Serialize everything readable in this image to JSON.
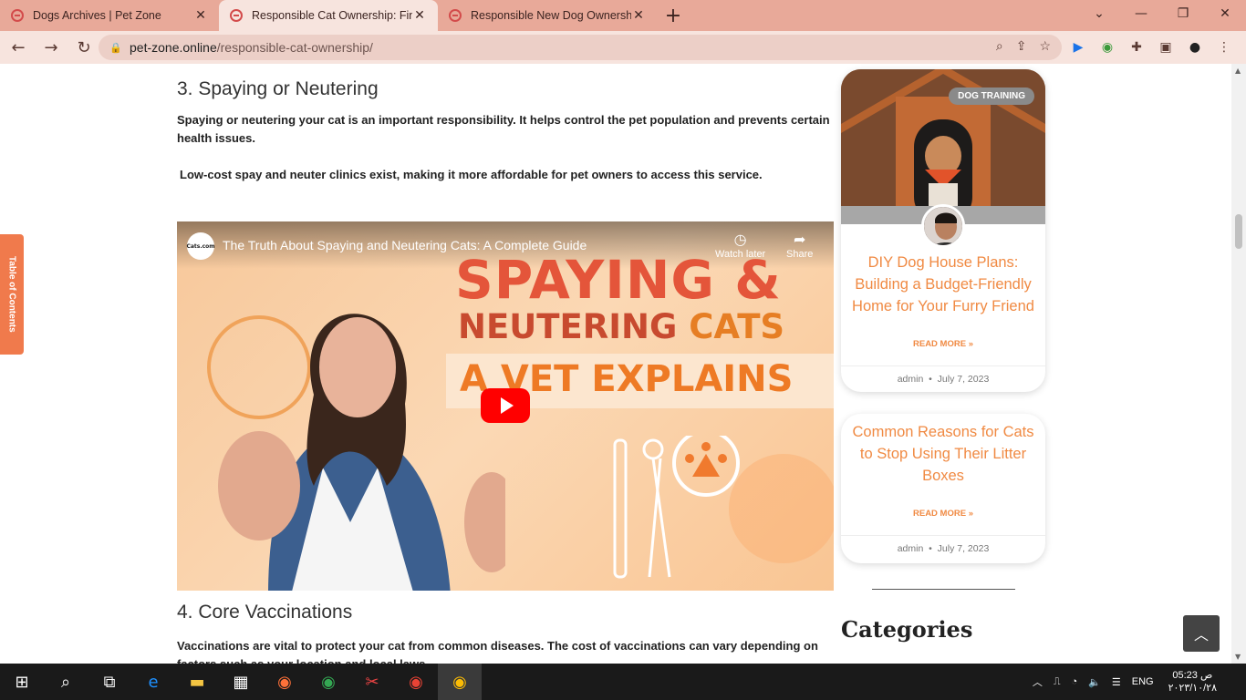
{
  "browser": {
    "tabs": [
      {
        "title": "Dogs Archives | Pet Zone",
        "active": false
      },
      {
        "title": "Responsible Cat Ownership: Fina",
        "active": true
      },
      {
        "title": "Responsible New Dog Ownershi",
        "active": false
      }
    ],
    "url_host": "pet-zone.online",
    "url_path": "/responsible-cat-ownership/"
  },
  "toc": {
    "label": "Table of Contents"
  },
  "article": {
    "section3_title": "3. Spaying or Neutering",
    "section3_p1": "Spaying or neutering your cat is an important responsibility. It helps control the pet population and prevents certain health issues.",
    "section3_p2": "Low-cost spay and neuter clinics exist, making it more affordable for pet owners to access this service.",
    "video": {
      "channel": "Cats.com",
      "title": "The Truth About Spaying and Neutering Cats: A Complete Guide",
      "watch_later": "Watch later",
      "share": "Share",
      "overlay_line1": "SPAYING &",
      "overlay_line2a": "NEUTERING ",
      "overlay_line2b": "CATS",
      "overlay_line3": "A VET EXPLAINS"
    },
    "section4_title": "4. Core Vaccinations",
    "section4_p1": "Vaccinations are vital to protect your cat from common diseases. The cost of vaccinations can vary depending on factors such as your location and local laws."
  },
  "sidebar": {
    "cards": [
      {
        "badge": "DOG TRAINING",
        "title": "DIY Dog House Plans: Building a Budget-Friendly Home for Your Furry Friend",
        "read_more": "READ MORE »",
        "author": "admin",
        "date": "July 7, 2023"
      },
      {
        "title": "Common Reasons for Cats to Stop Using Their Litter Boxes",
        "read_more": "READ MORE »",
        "author": "admin",
        "date": "July 7, 2023"
      }
    ],
    "categories_title": "Categories"
  },
  "taskbar": {
    "lang": "ENG",
    "time": "05:23 ص",
    "date": "٢٠٢٣/١٠/٢٨"
  },
  "colors": {
    "accent_orange": "#f08a43",
    "tab_bar": "#e8a999",
    "progress": "#3ec78a"
  }
}
